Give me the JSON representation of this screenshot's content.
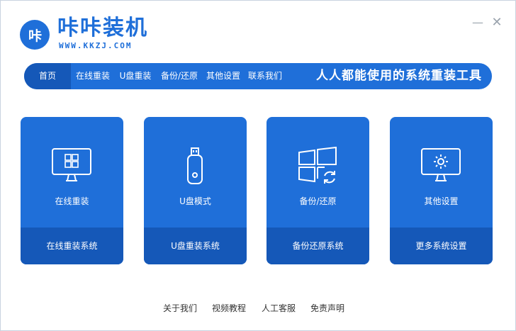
{
  "brand": {
    "logo_text": "咔",
    "name": "咔咔装机",
    "url": "WWW.KKZJ.COM"
  },
  "window_controls": {
    "minimize": "—",
    "close": "✕"
  },
  "nav": {
    "items": [
      "首页",
      "在线重装",
      "U盘重装",
      "备份/还原",
      "其他设置",
      "联系我们"
    ],
    "slogan": "人人都能使用的系统重装工具"
  },
  "cards": [
    {
      "title": "在线重装",
      "action": "在线重装系统",
      "icon": "windows-monitor-icon"
    },
    {
      "title": "U盘模式",
      "action": "U盘重装系统",
      "icon": "usb-drive-icon"
    },
    {
      "title": "备份/还原",
      "action": "备份还原系统",
      "icon": "windows-restore-icon"
    },
    {
      "title": "其他设置",
      "action": "更多系统设置",
      "icon": "settings-monitor-icon"
    }
  ],
  "footer": {
    "links": [
      "关于我们",
      "视频教程",
      "人工客服",
      "免责声明"
    ]
  },
  "colors": {
    "primary": "#1f6fd9",
    "primary_dark": "#1558b8"
  }
}
